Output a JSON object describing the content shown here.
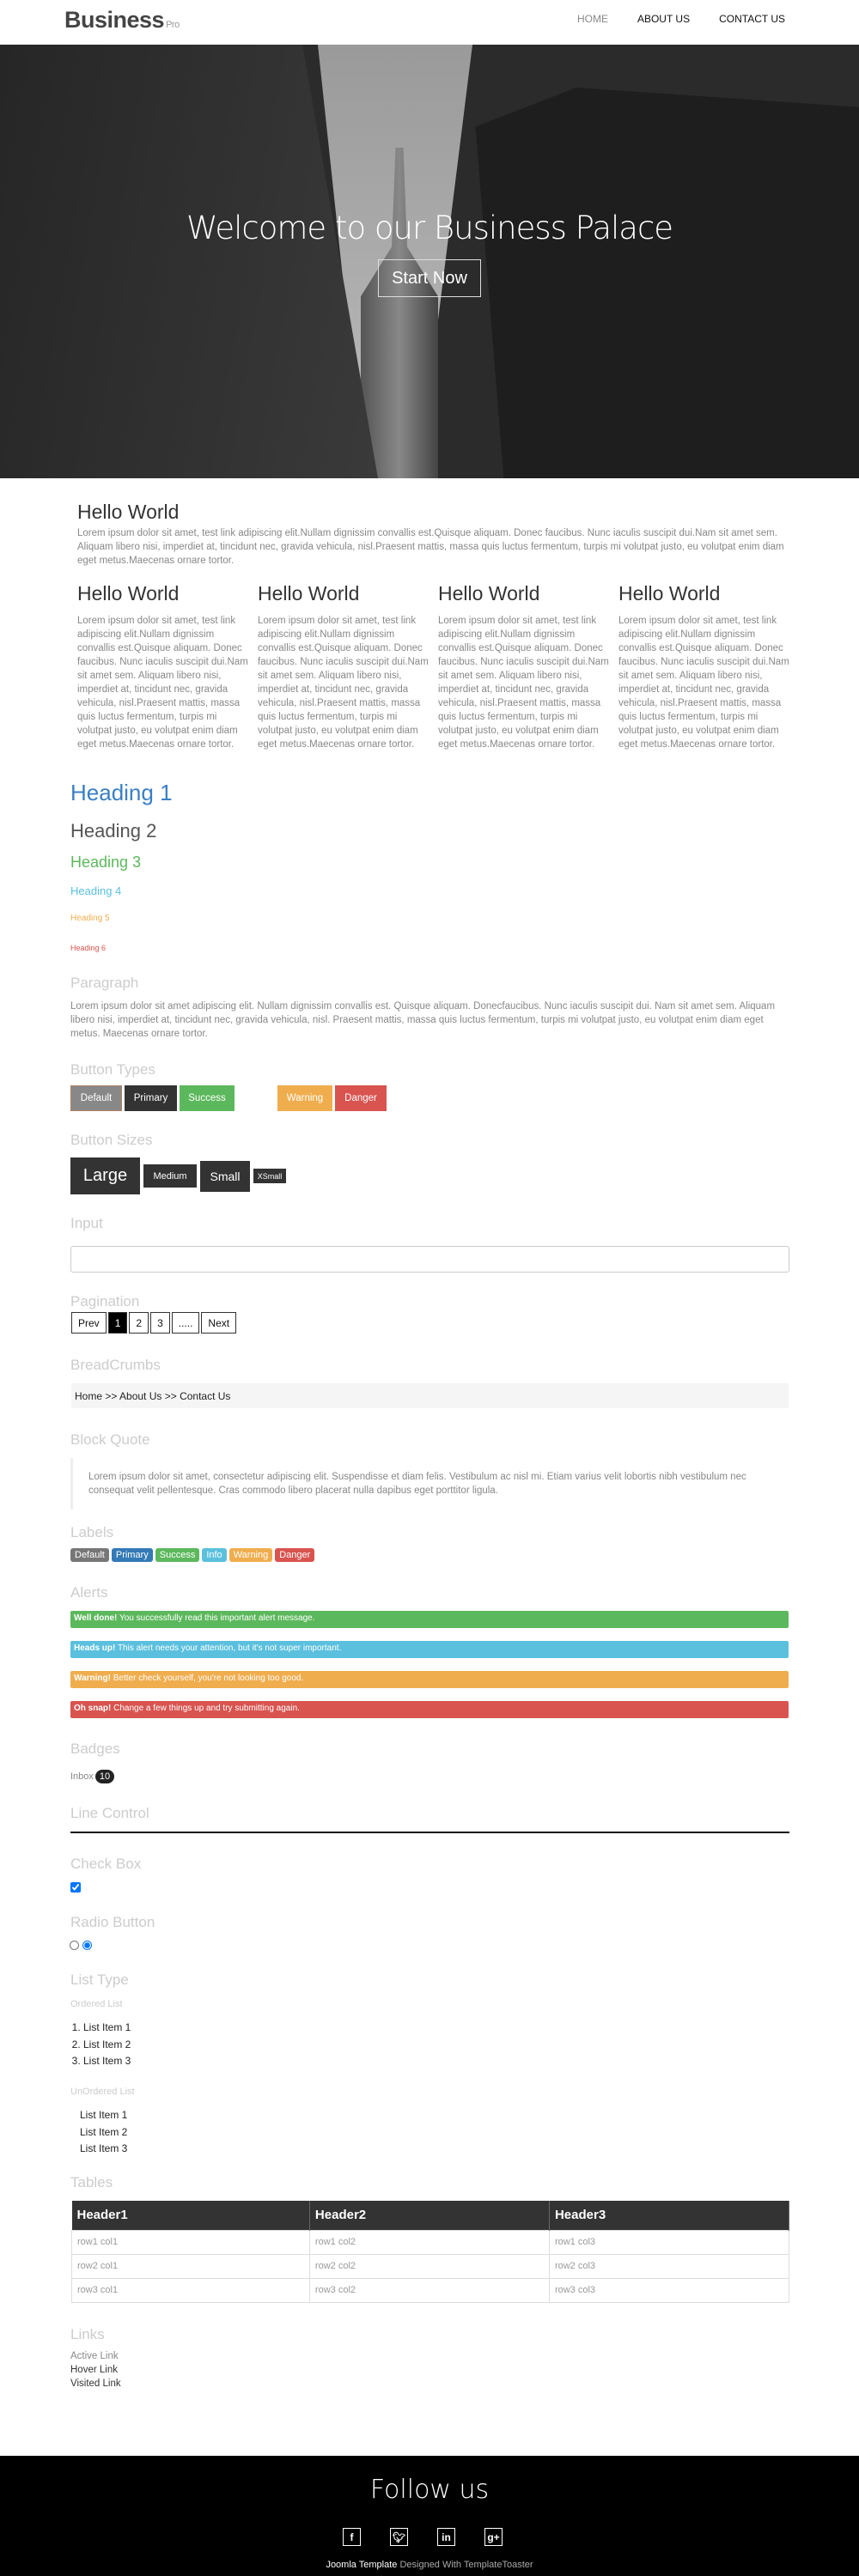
{
  "header": {
    "logo": "Business",
    "logo_suffix": "Pro",
    "nav": [
      "HOME",
      "ABOUT US",
      "CONTACT US"
    ]
  },
  "hero": {
    "title": "Welcome to our Business Palace",
    "cta": "Start Now"
  },
  "intro": {
    "title": "Hello World",
    "text": "Lorem ipsum dolor sit amet, test link adipiscing elit.Nullam dignissim convallis est.Quisque aliquam. Donec faucibus. Nunc iaculis suscipit dui.Nam sit amet sem. Aliquam libero nisi, imperdiet at, tincidunt nec, gravida vehicula, nisl.Praesent mattis, massa quis luctus fermentum, turpis mi volutpat justo, eu volutpat enim diam eget metus.Maecenas ornare tortor."
  },
  "columns": [
    {
      "title": "Hello World",
      "text": "Lorem ipsum dolor sit amet, test link adipiscing elit.Nullam dignissim convallis est.Quisque aliquam. Donec faucibus. Nunc iaculis suscipit dui.Nam sit amet sem. Aliquam libero nisi, imperdiet at, tincidunt nec, gravida vehicula, nisl.Praesent mattis, massa quis luctus fermentum, turpis mi volutpat justo, eu volutpat enim diam eget metus.Maecenas ornare tortor."
    },
    {
      "title": "Hello World",
      "text": "Lorem ipsum dolor sit amet, test link adipiscing elit.Nullam dignissim convallis est.Quisque aliquam. Donec faucibus. Nunc iaculis suscipit dui.Nam sit amet sem. Aliquam libero nisi, imperdiet at, tincidunt nec, gravida vehicula, nisl.Praesent mattis, massa quis luctus fermentum, turpis mi volutpat justo, eu volutpat enim diam eget metus.Maecenas ornare tortor."
    },
    {
      "title": "Hello World",
      "text": "Lorem ipsum dolor sit amet, test link adipiscing elit.Nullam dignissim convallis est.Quisque aliquam. Donec faucibus. Nunc iaculis suscipit dui.Nam sit amet sem. Aliquam libero nisi, imperdiet at, tincidunt nec, gravida vehicula, nisl.Praesent mattis, massa quis luctus fermentum, turpis mi volutpat justo, eu volutpat enim diam eget metus.Maecenas ornare tortor."
    },
    {
      "title": "Hello World",
      "text": "Lorem ipsum dolor sit amet, test link adipiscing elit.Nullam dignissim convallis est.Quisque aliquam. Donec faucibus. Nunc iaculis suscipit dui.Nam sit amet sem. Aliquam libero nisi, imperdiet at, tincidunt nec, gravida vehicula, nisl.Praesent mattis, massa quis luctus fermentum, turpis mi volutpat justo, eu volutpat enim diam eget metus.Maecenas ornare tortor."
    }
  ],
  "headings": [
    "Heading 1",
    "Heading 2",
    "Heading 3",
    "Heading 4",
    "Heading 5",
    "Heading 6"
  ],
  "heading_colors": [
    "#3a7fc4",
    "#555555",
    "#5cb85c",
    "#5bc0de",
    "#f0ad4e",
    "#d9534f"
  ],
  "paragraph": {
    "title": "Paragraph",
    "text": "Lorem ipsum dolor sit amet adipiscing elit. Nullam dignissim convallis est. Quisque aliquam. Donecfaucibus. Nunc iaculis suscipit dui. Nam sit amet sem. Aliquam libero nisi, imperdiet at, tincidunt nec, gravida vehicula, nisl. Praesent mattis, massa quis luctus fermentum, turpis mi volutpat justo, eu volutpat enim diam eget metus. Maecenas ornare tortor."
  },
  "button_types": {
    "title": "Button Types",
    "buttons": [
      "Default",
      "Primary",
      "Success",
      "Warning",
      "Danger"
    ]
  },
  "button_sizes": {
    "title": "Button Sizes",
    "buttons": [
      "Large",
      "Medium",
      "Small",
      "XSmall"
    ]
  },
  "input": {
    "title": "Input",
    "value": ""
  },
  "pagination": {
    "title": "Pagination",
    "items": [
      "Prev",
      "1",
      "2",
      "3",
      ".....",
      "Next"
    ],
    "active": "1"
  },
  "breadcrumbs": {
    "title": "BreadCrumbs",
    "text": "Home >> About Us >> Contact Us"
  },
  "blockquote": {
    "title": "Block Quote",
    "text": "Lorem ipsum dolor sit amet, consectetur adipiscing elit. Suspendisse et diam felis. Vestibulum ac nisl mi. Etiam varius velit lobortis nibh vestibulum nec consequat velit pellentesque. Cras commodo libero placerat nulla dapibus eget porttitor ligula."
  },
  "labels": {
    "title": "Labels",
    "items": [
      "Default",
      "Primary",
      "Success",
      "Info",
      "Warning",
      "Danger"
    ]
  },
  "alerts": {
    "title": "Alerts",
    "items": [
      {
        "strong": "Well done!",
        "text": " You successfully read this important alert message."
      },
      {
        "strong": "Heads up!",
        "text": " This alert needs your attention, but it's not super important."
      },
      {
        "strong": "Warning!",
        "text": " Better check yourself, you're not looking too good."
      },
      {
        "strong": "Oh snap!",
        "text": " Change a few things up and try submitting again."
      }
    ]
  },
  "badges": {
    "title": "Badges",
    "label": "Inbox",
    "count": "10"
  },
  "line_control": {
    "title": "Line Control"
  },
  "checkbox": {
    "title": "Check Box",
    "checked": true
  },
  "radio": {
    "title": "Radio Button",
    "selected": 2
  },
  "lists": {
    "title": "List Type",
    "ordered_title": "Ordered List",
    "ordered": [
      "List Item 1",
      "List Item 2",
      "List Item 3"
    ],
    "unordered_title": "UnOrdered List",
    "unordered": [
      "List Item 1",
      "List Item 2",
      "List Item 3"
    ]
  },
  "table": {
    "title": "Tables",
    "headers": [
      "Header1",
      "Header2",
      "Header3"
    ],
    "rows": [
      [
        "row1 col1",
        "row1 col2",
        "row1 col3"
      ],
      [
        "row2 col1",
        "row2 col2",
        "row2 col3"
      ],
      [
        "row3 col1",
        "row3 col2",
        "row3 col3"
      ]
    ]
  },
  "links": {
    "title": "Links",
    "items": [
      "Active Link",
      "Hover Link",
      "Visited Link"
    ]
  },
  "footer": {
    "title": "Follow us",
    "social": [
      "facebook-icon",
      "twitter-icon",
      "linkedin-icon",
      "google-plus-icon"
    ],
    "credit_strong": "Joomla Template",
    "credit": " Designed With TemplateToaster"
  },
  "colors": {
    "default": "#888888",
    "primary": "#333333",
    "success": "#5cb85c",
    "info": "#5bc0de",
    "warning": "#f0ad4e",
    "danger": "#d9534f",
    "label_primary": "#337ab7"
  }
}
